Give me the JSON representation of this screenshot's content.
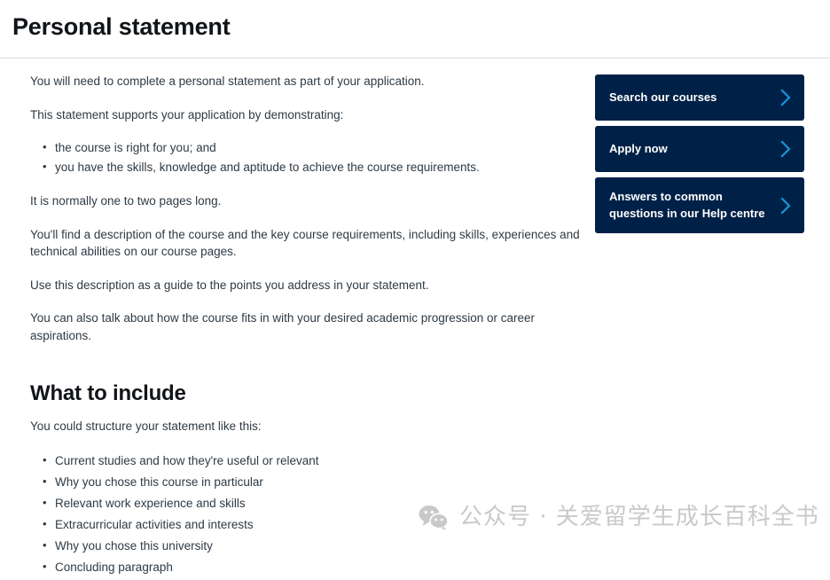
{
  "header": {
    "title": "Personal statement"
  },
  "main": {
    "intro_paragraph": "You will need to complete a personal statement as part of your application.",
    "supports_paragraph": "This statement supports your application by demonstrating:",
    "supports_bullets": [
      "the course is right for you; and",
      "you have the skills, knowledge and aptitude to achieve the course requirements."
    ],
    "length_paragraph": "It is normally one to two pages long.",
    "description_paragraph": "You'll find a description of the course and the key course requirements, including skills, experiences and technical abilities on our course pages.",
    "guide_paragraph": "Use this description as a guide to the points you address in your statement.",
    "aspirations_paragraph": "You can also talk about how the course fits in with your desired academic progression or career aspirations.",
    "section": {
      "heading": "What to include",
      "intro": "You could structure your statement like this:",
      "items": [
        "Current studies and how they're useful or relevant",
        "Why you chose this course in particular",
        "Relevant work experience and skills",
        "Extracurricular activities and interests",
        "Why you chose this university",
        "Concluding paragraph"
      ]
    }
  },
  "sidebar": {
    "buttons": [
      {
        "label": "Search our courses",
        "icon": "chevron-right-icon"
      },
      {
        "label": "Apply now",
        "icon": "chevron-right-icon"
      },
      {
        "label": "Answers to common\nquestions in our Help centre",
        "icon": "chevron-right-icon"
      }
    ]
  },
  "watermark": {
    "icon": "wechat-icon",
    "text": "公众号 · 关爱留学生成长百科全书"
  },
  "colors": {
    "cta_background": "#002147",
    "cta_text": "#ffffff",
    "chevron": "#1596d8",
    "body_text": "#2e3a44",
    "heading_text": "#111418",
    "divider": "#dcdcdc",
    "page_background": "#ffffff",
    "watermark_text": "#c9c9c9"
  }
}
